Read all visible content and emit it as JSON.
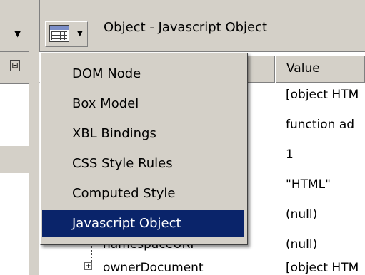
{
  "toolbar": {
    "title": "Object - Javascript Object",
    "view_icon": "table-view-icon",
    "dropdown_icon": "chevron-down-icon"
  },
  "columns": {
    "value_header": "Value"
  },
  "menu": {
    "items": [
      {
        "label": "DOM Node"
      },
      {
        "label": "Box Model"
      },
      {
        "label": "XBL Bindings"
      },
      {
        "label": "CSS Style Rules"
      },
      {
        "label": "Computed Style"
      },
      {
        "label": "Javascript Object"
      }
    ],
    "selected": "Javascript Object"
  },
  "rows": [
    {
      "value": "[object HTM"
    },
    {
      "value": "function ad"
    },
    {
      "value": "1"
    },
    {
      "value": "\"HTML\""
    },
    {
      "value": "(null)"
    },
    {
      "name": "namespaceURI",
      "value": "(null)"
    },
    {
      "name": "ownerDocument",
      "value": "[object HTM",
      "expander": "+"
    }
  ],
  "colors": {
    "selection": "#0a246a",
    "chrome": "#d4d0c8"
  }
}
